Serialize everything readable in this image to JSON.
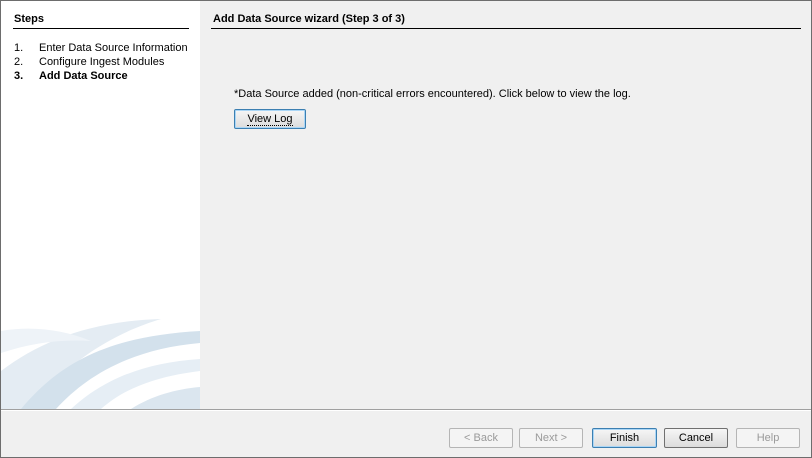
{
  "steps": {
    "title": "Steps",
    "items": [
      {
        "num": "1.",
        "label": "Enter Data Source Information",
        "active": false
      },
      {
        "num": "2.",
        "label": "Configure Ingest Modules",
        "active": false
      },
      {
        "num": "3.",
        "label": "Add Data Source",
        "active": true
      }
    ]
  },
  "main": {
    "title": "Add Data Source wizard (Step 3 of 3)",
    "message": "*Data Source added (non-critical errors encountered). Click below to view the log.",
    "view_log_label": "View Log"
  },
  "footer": {
    "back_label": "< Back",
    "next_label": "Next >",
    "finish_label": "Finish",
    "cancel_label": "Cancel",
    "help_label": "Help"
  }
}
